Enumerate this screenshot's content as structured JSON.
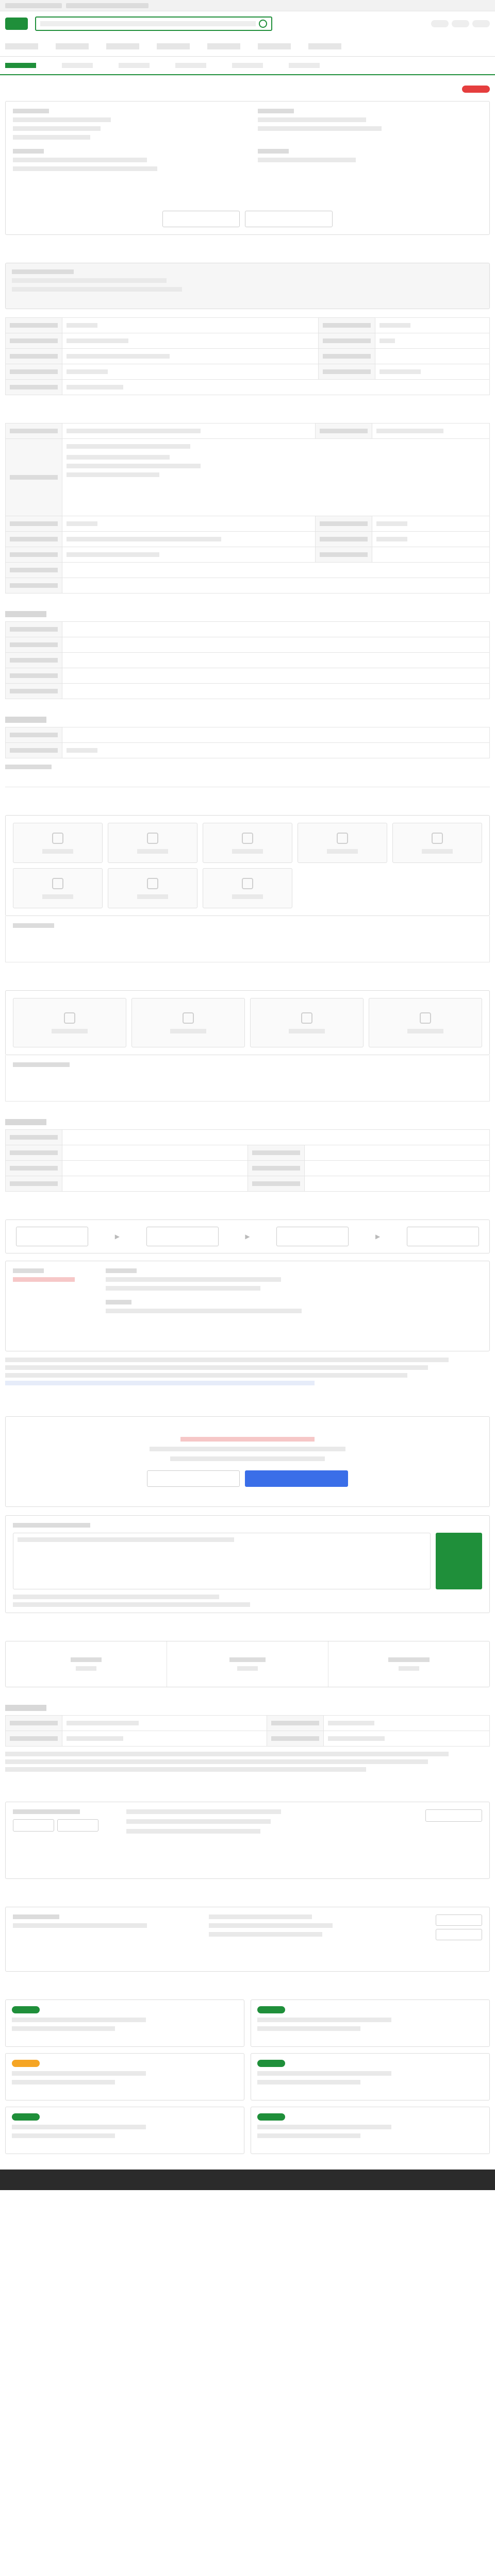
{
  "page": {
    "title": "",
    "org": ""
  },
  "sections": {
    "recruit": "",
    "conditions": "",
    "welfare": "",
    "disability": "",
    "process": "",
    "contact": "",
    "apply_status": "",
    "company": "",
    "similar": "",
    "nearby": ""
  },
  "header": {
    "search_placeholder": ""
  },
  "colors": {
    "primary": "#1f8f3a",
    "accent_blue": "#3a6ee8",
    "alert_red": "#e53e3e",
    "orange": "#f5a524"
  }
}
